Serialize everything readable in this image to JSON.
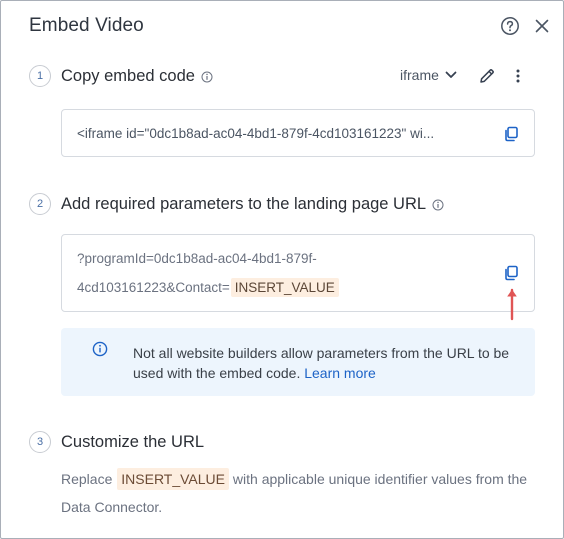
{
  "header": {
    "title": "Embed Video"
  },
  "step1": {
    "number": "1",
    "title": "Copy embed code",
    "format_label": "iframe",
    "code": "<iframe id=\"0dc1b8ad-ac04-4bd1-879f-4cd103161223\" wi..."
  },
  "step2": {
    "number": "2",
    "title": "Add required parameters to the landing page URL",
    "param_line1": "?programId=0dc1b8ad-ac04-4bd1-879f-",
    "param_line2": "4cd103161223&Contact=",
    "param_token": "INSERT_VALUE",
    "notice_text": "Not all website builders allow parameters from the URL to be used with the embed code.",
    "notice_link": "Learn more"
  },
  "step3": {
    "number": "3",
    "title": "Customize the URL",
    "desc_prefix": "Replace",
    "desc_token": "INSERT_VALUE",
    "desc_suffix": "with applicable unique identifier values from the Data Connector."
  },
  "colors": {
    "accent": "#1d63c7",
    "arrow": "#e05555",
    "chip_bg": "#fdeee0",
    "notice_bg": "#edf5fd"
  }
}
